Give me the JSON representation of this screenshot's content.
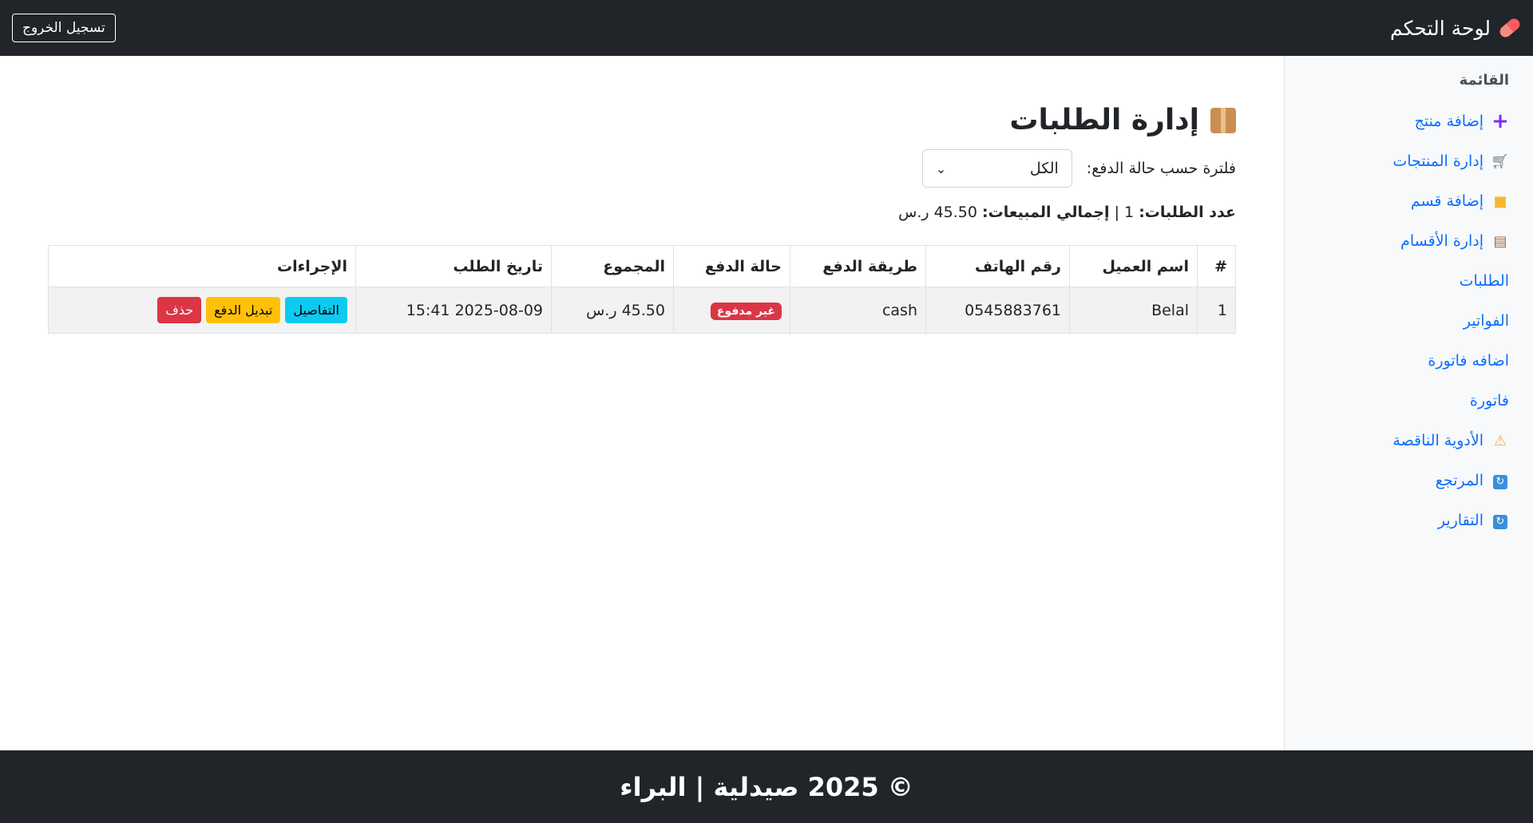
{
  "navbar": {
    "brand": "لوحة التحكم",
    "brand_icon": "pill-icon",
    "logout_label": "تسجيل الخروج"
  },
  "sidebar": {
    "title": "القائمة",
    "items": [
      {
        "label": "إضافة منتج",
        "icon": "plus-icon"
      },
      {
        "label": "إدارة المنتجات",
        "icon": "cart-icon"
      },
      {
        "label": "إضافة قسم",
        "icon": "folder-icon"
      },
      {
        "label": "إدارة الأقسام",
        "icon": "clipboard-icon"
      },
      {
        "label": "الطلبات",
        "icon": ""
      },
      {
        "label": "الفواتير",
        "icon": ""
      },
      {
        "label": "اضافه فاتورة",
        "icon": ""
      },
      {
        "label": "فاتورة",
        "icon": ""
      },
      {
        "label": "الأدوية الناقصة",
        "icon": "warning-icon"
      },
      {
        "label": "المرتجع",
        "icon": "refresh-icon"
      },
      {
        "label": "التقارير",
        "icon": "refresh-icon"
      }
    ]
  },
  "main": {
    "title": "إدارة الطلبات",
    "title_icon": "package-icon",
    "filter": {
      "label": "فلترة حسب حالة الدفع:",
      "selected": "الكل"
    },
    "summary": {
      "orders_label": "عدد الطلبات:",
      "orders_count": "1",
      "separator": "|",
      "sales_label": "إجمالي المبيعات:",
      "sales_value": "45.50 ر.س"
    },
    "table": {
      "headers": [
        "#",
        "اسم العميل",
        "رقم الهاتف",
        "طريقة الدفع",
        "حالة الدفع",
        "المجموع",
        "تاريخ الطلب",
        "الإجراءات"
      ],
      "rows": [
        {
          "index": "1",
          "customer": "Belal",
          "phone": "0545883761",
          "method": "cash",
          "status": "غير مدفوع",
          "total": "45.50 ر.س",
          "date": "2025-08-09 15:41",
          "details_label": "التفاصيل",
          "toggle_label": "تبديل الدفع",
          "delete_label": "حذف"
        }
      ]
    }
  },
  "footer": {
    "text": "© 2025 صيدلية | البراء"
  },
  "colors": {
    "navbar_bg": "#212529",
    "link": "#0d6efd",
    "danger": "#dc3545",
    "warning": "#ffc107",
    "info": "#0dcaf0"
  }
}
